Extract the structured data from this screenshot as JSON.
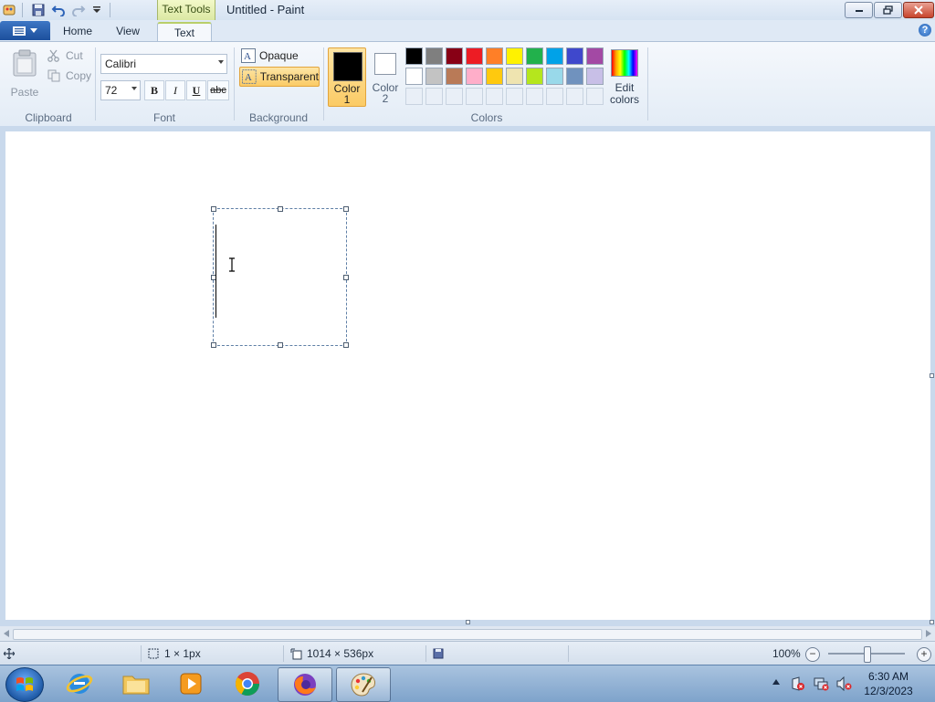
{
  "window": {
    "title": "Untitled - Paint",
    "context_tab": "Text Tools"
  },
  "tabs": {
    "home": "Home",
    "view": "View",
    "text": "Text"
  },
  "ribbon": {
    "clipboard": {
      "label": "Clipboard",
      "paste": "Paste",
      "cut": "Cut",
      "copy": "Copy"
    },
    "font": {
      "label": "Font",
      "family": "Calibri",
      "size": "72",
      "bold": "B",
      "italic": "I",
      "underline": "U",
      "strikethrough": "abc"
    },
    "background": {
      "label": "Background",
      "opaque": "Opaque",
      "transparent": "Transparent",
      "selected": "transparent"
    },
    "colors": {
      "label": "Colors",
      "color1_label": "Color",
      "color1_num": "1",
      "color2_label": "Color",
      "color2_num": "2",
      "color1": "#000000",
      "color2": "#ffffff",
      "edit_label": "Edit",
      "edit_label2": "colors",
      "palette_row1": [
        "#000000",
        "#7f7f7f",
        "#880015",
        "#ed1c24",
        "#ff7f27",
        "#fff200",
        "#22b14c",
        "#00a2e8",
        "#3f48cc",
        "#a349a4"
      ],
      "palette_row2": [
        "#ffffff",
        "#c3c3c3",
        "#b97a57",
        "#ffaec9",
        "#ffc90e",
        "#efe4b0",
        "#b5e61d",
        "#99d9ea",
        "#7092be",
        "#c8bfe7"
      ]
    }
  },
  "status": {
    "selection_size": "1 × 1px",
    "canvas_size": "1014 × 536px",
    "zoom": "100%"
  },
  "taskbar": {
    "time": "6:30 AM",
    "date": "12/3/2023"
  }
}
